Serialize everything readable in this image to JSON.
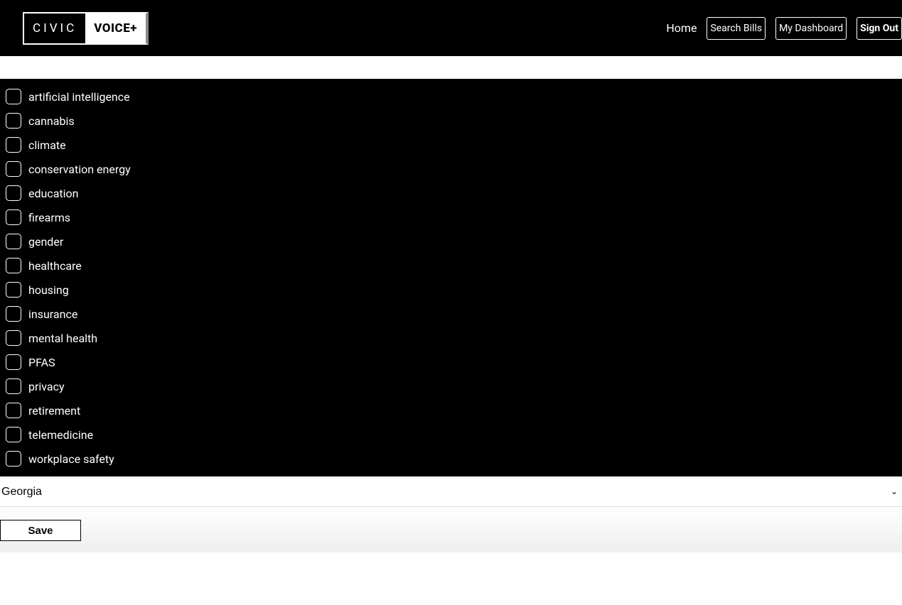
{
  "logo": {
    "left": "CIVIC",
    "right": "VOICE+"
  },
  "nav": {
    "home": "Home",
    "search_bills": "Search Bills",
    "my_dashboard": "My Dashboard",
    "sign_out": "Sign Out"
  },
  "topics": [
    "artificial intelligence",
    "cannabis",
    "climate",
    "conservation energy",
    "education",
    "firearms",
    "gender",
    "healthcare",
    "housing",
    "insurance",
    "mental health",
    "PFAS",
    "privacy",
    "retirement",
    "telemedicine",
    "workplace safety"
  ],
  "state_select": {
    "value": "Georgia"
  },
  "save_label": "Save"
}
